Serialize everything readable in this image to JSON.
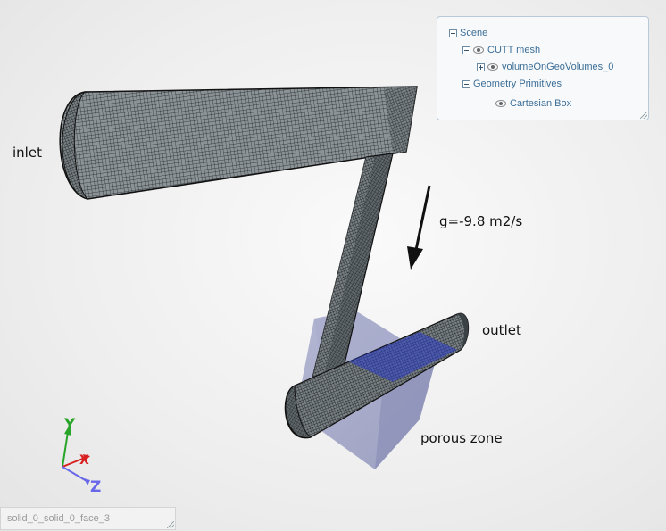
{
  "scene_tree": {
    "items": [
      {
        "label": "Scene",
        "toggle": "minus",
        "eye": false,
        "indent": 0
      },
      {
        "label": "CUTT mesh",
        "toggle": "minus",
        "eye": true,
        "indent": 1
      },
      {
        "label": "volumeOnGeoVolumes_0",
        "toggle": "plus",
        "eye": true,
        "indent": 2
      },
      {
        "label": "Geometry Primitives",
        "toggle": "minus",
        "eye": false,
        "indent": 1
      },
      {
        "label": "Cartesian Box",
        "toggle": "none",
        "eye": true,
        "indent": 3
      }
    ]
  },
  "annotations": {
    "inlet": "inlet",
    "gravity": "g=-9.8 m2/s",
    "outlet": "outlet",
    "porous": "porous zone"
  },
  "axes": {
    "y": "Y",
    "x": "X",
    "z": "Z"
  },
  "status": {
    "selection": "solid_0_solid_0_face_3"
  },
  "colors": {
    "mesh_fill": "#8a9296",
    "mesh_line": "#1a1a1a",
    "porous_box": "#8c90b5",
    "highlight": "#2a3cc8",
    "axis_y": "#28a428",
    "axis_x": "#d82020",
    "axis_z": "#6868e8"
  }
}
